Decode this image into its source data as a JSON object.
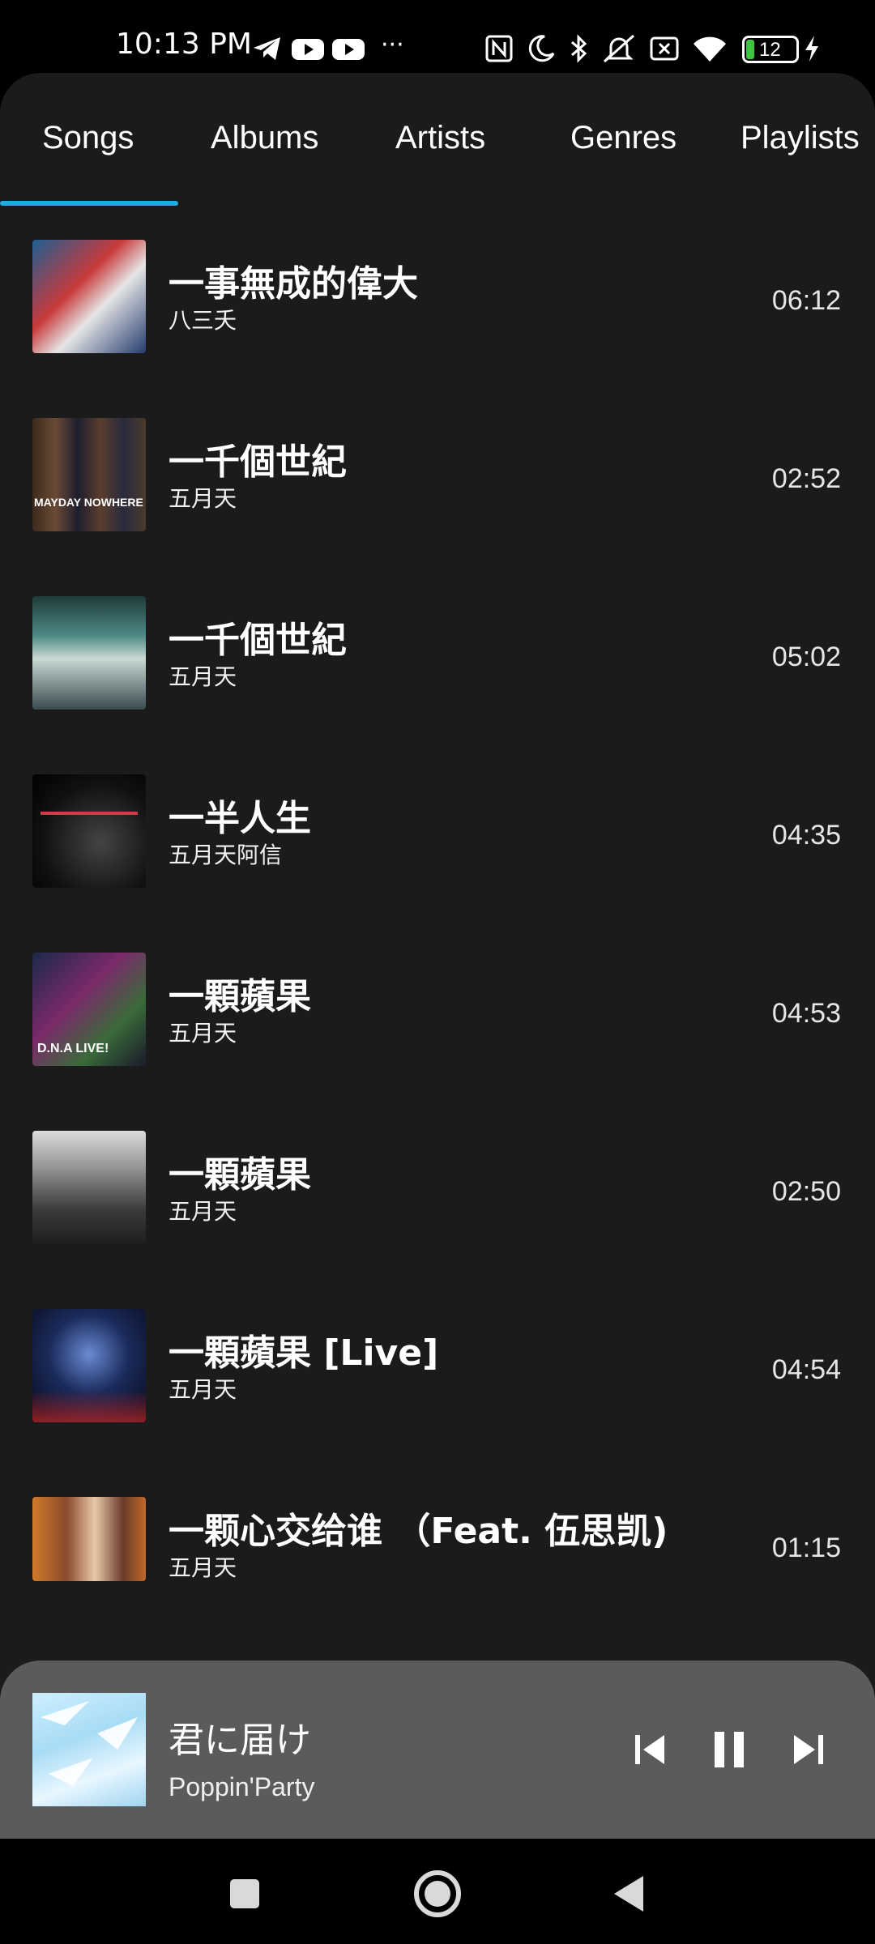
{
  "status_bar": {
    "time": "10:13 PM",
    "icons": [
      "telegram-icon",
      "youtube-icon",
      "youtube-icon",
      "more-dots-icon",
      "nfc-icon",
      "moon-icon",
      "bluetooth-icon",
      "mute-icon",
      "sim-off-icon",
      "wifi-icon",
      "battery-icon",
      "charging-icon"
    ],
    "more": "···",
    "battery_level": "12"
  },
  "tabs": [
    {
      "label": "Songs",
      "selected": true
    },
    {
      "label": "Albums",
      "selected": false
    },
    {
      "label": "Artists",
      "selected": false
    },
    {
      "label": "Genres",
      "selected": false
    },
    {
      "label": "Playlists",
      "selected": false
    }
  ],
  "accent_color": "#24a9e1",
  "songs": [
    {
      "title": "一事無成的偉大",
      "artist": "八三夭",
      "duration": "06:12"
    },
    {
      "title": "一千個世紀",
      "artist": "五月天",
      "duration": "02:52",
      "art_text": "MAYDAY NOWHERE"
    },
    {
      "title": "一千個世紀",
      "artist": "五月天",
      "duration": "05:02"
    },
    {
      "title": "一半人生",
      "artist": "五月天阿信",
      "duration": "04:35"
    },
    {
      "title": "一顆蘋果",
      "artist": "五月天",
      "duration": "04:53",
      "art_text": "D.N.A LIVE!"
    },
    {
      "title": "一顆蘋果",
      "artist": "五月天",
      "duration": "02:50"
    },
    {
      "title": "一顆蘋果 [Live]",
      "artist": "五月天",
      "duration": "04:54"
    },
    {
      "title": "一颗心交给谁 （Feat. 伍思凯)",
      "artist": "五月天",
      "duration": "01:15"
    }
  ],
  "now_playing": {
    "title": "君に届け",
    "artist": "Poppin'Party",
    "controls": [
      "previous-icon",
      "pause-icon",
      "next-icon"
    ]
  },
  "nav_bar": [
    "recents-square-icon",
    "home-circle-icon",
    "back-triangle-icon"
  ]
}
